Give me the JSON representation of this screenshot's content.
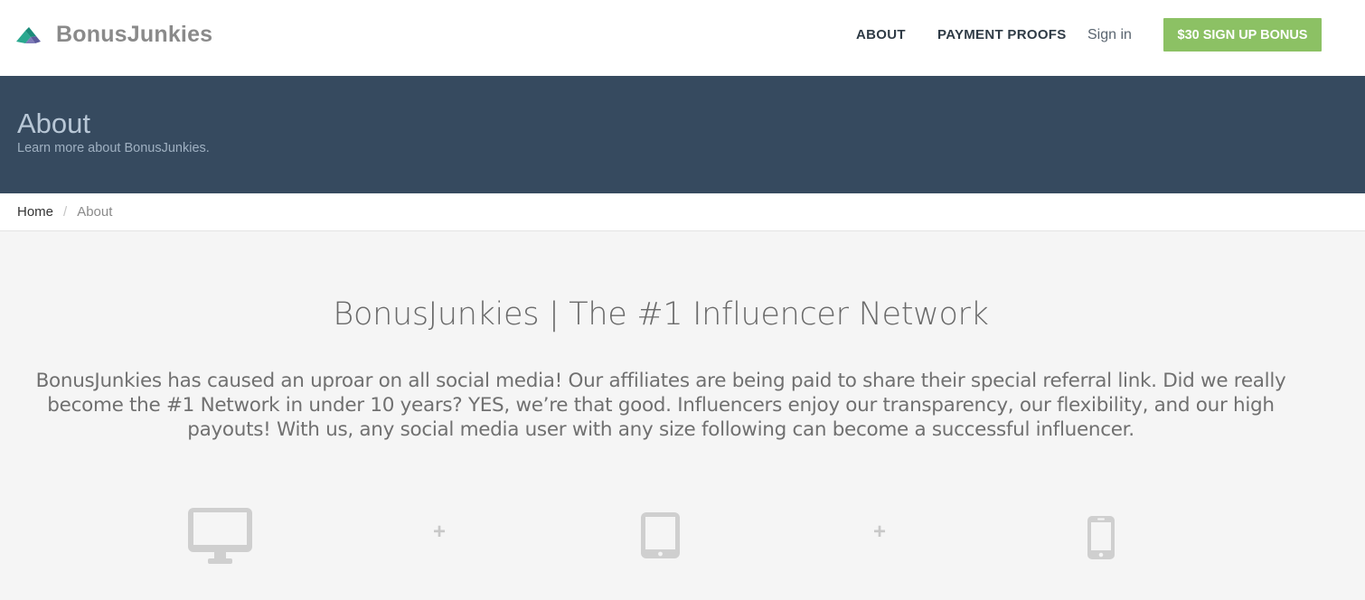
{
  "header": {
    "brand_name": "BonusJunkies",
    "nav": {
      "about": "ABOUT",
      "payment_proofs": "PAYMENT PROOFS",
      "sign_in": "Sign in",
      "signup_bonus": "$30 SIGN UP BONUS"
    }
  },
  "hero": {
    "title": "About",
    "subtitle": "Learn more about BonusJunkies."
  },
  "breadcrumb": {
    "home": "Home",
    "separator": "/",
    "current": "About"
  },
  "main": {
    "title": "BonusJunkies | The #1 Influencer Network",
    "body": "BonusJunkies has caused an uproar on all social media! Our affiliates are being paid to share their special referral link. Did we really become the #1 Network in under 10 years? YES, we’re that good. Influencers enjoy our transparency, our flexibility, and our high payouts! With us, any social media user with any size following can become a successful influencer.",
    "devices": [
      "desktop-icon",
      "tablet-icon",
      "phone-icon"
    ],
    "plus_symbol": "+"
  },
  "colors": {
    "hero_bg": "#364a5f",
    "cta_bg": "#8cc164",
    "page_bg": "#f5f5f5",
    "logo_teal": "#1f9f8c",
    "logo_purple": "#5c5a9c"
  }
}
